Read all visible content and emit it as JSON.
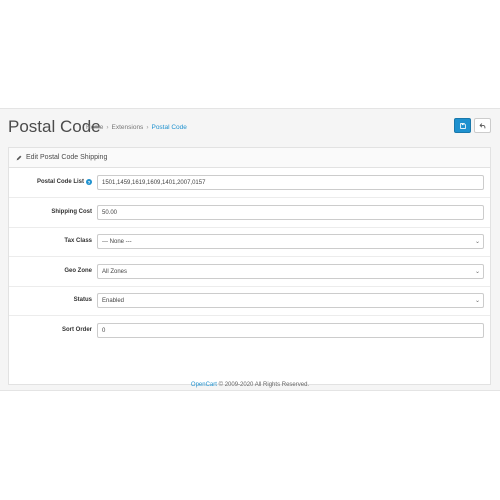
{
  "header": {
    "title": "Postal Code",
    "breadcrumb": [
      "Home",
      "Extensions",
      "Postal Code"
    ],
    "save_icon": "save-icon",
    "back_icon": "reply-icon"
  },
  "panel": {
    "heading": "Edit Postal Code Shipping",
    "heading_icon": "pencil-icon"
  },
  "form": {
    "postal_code_list": {
      "label": "Postal Code List",
      "value": "1501,1459,1619,1609,1401,2007,0157"
    },
    "shipping_cost": {
      "label": "Shipping Cost",
      "value": "50.00"
    },
    "tax_class": {
      "label": "Tax Class",
      "value": " --- None --- "
    },
    "geo_zone": {
      "label": "Geo Zone",
      "value": "All Zones"
    },
    "status": {
      "label": "Status",
      "value": "Enabled"
    },
    "sort_order": {
      "label": "Sort Order",
      "value": "0"
    }
  },
  "footer": {
    "link": "OpenCart",
    "text": " © 2009-2020 All Rights Reserved."
  },
  "colors": {
    "accent": "#1e91cf",
    "background": "#f5f5f5"
  }
}
